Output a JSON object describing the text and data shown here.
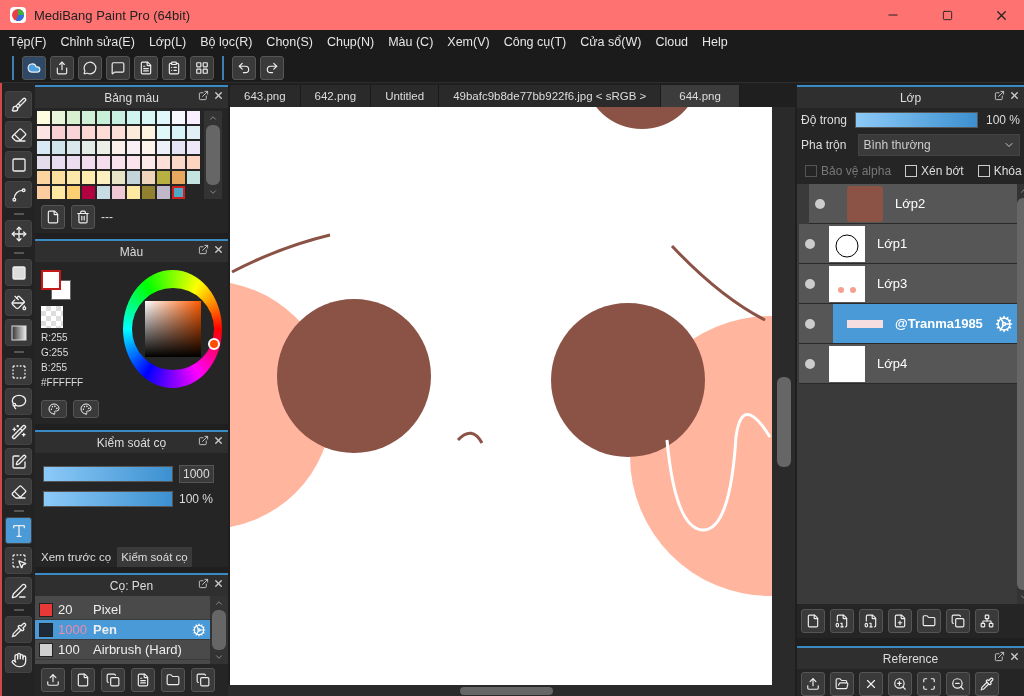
{
  "window": {
    "title": "MediBang Paint Pro (64bit)"
  },
  "menu": [
    "Tệp(F)",
    "Chỉnh sửa(E)",
    "Lớp(L)",
    "Bộ lọc(R)",
    "Chọn(S)",
    "Chụp(N)",
    "Màu (C)",
    "Xem(V)",
    "Công cụ(T)",
    "Cửa sổ(W)",
    "Cloud",
    "Help"
  ],
  "tool_groups": [
    [
      {
        "selected": false
      },
      {
        "selected": false
      },
      {
        "selected": false
      },
      {
        "selected": false
      }
    ],
    [
      {
        "selected": false
      }
    ],
    [
      {
        "selected": false
      },
      {
        "selected": false
      },
      {
        "selected": false
      }
    ],
    [
      {
        "selected": false
      },
      {
        "selected": false
      },
      {
        "selected": false
      },
      {
        "selected": false
      },
      {
        "selected": false
      }
    ],
    [
      {
        "selected": true
      },
      {
        "selected": false
      },
      {
        "selected": false
      }
    ],
    [
      {
        "selected": false
      },
      {
        "selected": false
      }
    ]
  ],
  "palette": {
    "title": "Bảng màu",
    "name": "---",
    "swatches": [
      {
        "color": "#fffde0",
        "selected": false
      },
      {
        "color": "#e8f5d8",
        "selected": false
      },
      {
        "color": "#d8f0d0",
        "selected": false
      },
      {
        "color": "#d0f0d8",
        "selected": false
      },
      {
        "color": "#c8f0d8",
        "selected": false
      },
      {
        "color": "#c8f0e0",
        "selected": false
      },
      {
        "color": "#d0f5f0",
        "selected": false
      },
      {
        "color": "#d8f8f8",
        "selected": false
      },
      {
        "color": "#e0f8fc",
        "selected": false
      },
      {
        "color": "#f8f8ff",
        "selected": false
      },
      {
        "color": "#f8f0ff",
        "selected": false
      },
      {
        "color": "#fce4e4",
        "selected": false
      },
      {
        "color": "#f8d0d4",
        "selected": false
      },
      {
        "color": "#f8d4d8",
        "selected": false
      },
      {
        "color": "#fcd8d4",
        "selected": false
      },
      {
        "color": "#fcdcd4",
        "selected": false
      },
      {
        "color": "#fce0d8",
        "selected": false
      },
      {
        "color": "#fceada",
        "selected": false
      },
      {
        "color": "#fcf4e0",
        "selected": false
      },
      {
        "color": "#e0f8f8",
        "selected": false
      },
      {
        "color": "#d8f4f8",
        "selected": false
      },
      {
        "color": "#e0f0f4",
        "selected": false
      },
      {
        "color": "#d8e8f4",
        "selected": false
      },
      {
        "color": "#d0e4ec",
        "selected": false
      },
      {
        "color": "#d8e8ec",
        "selected": false
      },
      {
        "color": "#e4ece8",
        "selected": false
      },
      {
        "color": "#eceee8",
        "selected": false
      },
      {
        "color": "#fcf0ec",
        "selected": false
      },
      {
        "color": "#f8f0f4",
        "selected": false
      },
      {
        "color": "#fcf4ec",
        "selected": false
      },
      {
        "color": "#ecf0f8",
        "selected": false
      },
      {
        "color": "#e4e4f4",
        "selected": false
      },
      {
        "color": "#ece8f8",
        "selected": false
      },
      {
        "color": "#e4dcec",
        "selected": false
      },
      {
        "color": "#e8dcf0",
        "selected": false
      },
      {
        "color": "#ecdcf0",
        "selected": false
      },
      {
        "color": "#f0dcec",
        "selected": false
      },
      {
        "color": "#f4dcec",
        "selected": false
      },
      {
        "color": "#f8e0ec",
        "selected": false
      },
      {
        "color": "#fce4ec",
        "selected": false
      },
      {
        "color": "#fce8e8",
        "selected": false
      },
      {
        "color": "#fce0d8",
        "selected": false
      },
      {
        "color": "#fcd8c8",
        "selected": false
      },
      {
        "color": "#fcd4c0",
        "selected": false
      },
      {
        "color": "#fcd4a0",
        "selected": false
      },
      {
        "color": "#fce0a0",
        "selected": false
      },
      {
        "color": "#fce8a8",
        "selected": false
      },
      {
        "color": "#fcecb0",
        "selected": false
      },
      {
        "color": "#fcf0c0",
        "selected": false
      },
      {
        "color": "#e8e4c8",
        "selected": false
      },
      {
        "color": "#c4d4d8",
        "selected": false
      },
      {
        "color": "#f0d4bc",
        "selected": false
      },
      {
        "color": "#b8b040",
        "selected": false
      },
      {
        "color": "#e8a860",
        "selected": false
      },
      {
        "color": "#c4e4e0",
        "selected": false
      },
      {
        "color": "#fccca0",
        "selected": false
      },
      {
        "color": "#fce8a0",
        "selected": false
      },
      {
        "color": "#fcd070",
        "selected": false
      },
      {
        "color": "#b00040",
        "selected": false
      },
      {
        "color": "#c8dce4",
        "selected": false
      },
      {
        "color": "#f0c8d4",
        "selected": false
      },
      {
        "color": "#fce8a0",
        "selected": false
      },
      {
        "color": "#908030",
        "selected": false
      },
      {
        "color": "#c0b8c8",
        "selected": false
      },
      {
        "color": "#50a8c8",
        "selected": true
      }
    ]
  },
  "color_panel": {
    "title": "Màu",
    "r": "R:255",
    "g": "G:255",
    "b": "B:255",
    "hex": "#FFFFFF"
  },
  "brush_control": {
    "title": "Kiểm soát cọ",
    "size": {
      "level": 1,
      "value": "1000"
    },
    "opacity": {
      "level": 1,
      "value": "100 %"
    },
    "tabs": [
      {
        "label": "Xem trước cọ",
        "selected": false
      },
      {
        "label": "Kiểm soát cọ",
        "selected": true
      }
    ]
  },
  "brushes": {
    "title": "Cọ: Pen",
    "items": [
      {
        "size": "20",
        "name": "Pixel",
        "color": "#e83838",
        "selected": false
      },
      {
        "size": "1000",
        "name": "Pen",
        "color": "#1e2a38",
        "selected": true
      },
      {
        "size": "100",
        "name": "Airbrush (Hard)",
        "color": "#d0d0d0",
        "selected": false
      }
    ]
  },
  "tabs": [
    {
      "label": "643.png",
      "selected": false
    },
    {
      "label": "642.png",
      "selected": false
    },
    {
      "label": "Untitled",
      "selected": false
    },
    {
      "label": "49bafc9b8de77bb922f6.jpg < sRGB >",
      "selected": false
    },
    {
      "label": "644.png",
      "selected": true
    }
  ],
  "layers": {
    "title": "Lớp",
    "opacity_label": "Độ trong",
    "opacity": {
      "level": 1,
      "value": "100 %"
    },
    "blend_label": "Pha trộn",
    "blend": "Bình thường",
    "options": [
      {
        "label": "Bảo vệ alpha",
        "checked": false,
        "disabled": true
      },
      {
        "label": "Xén bớt",
        "checked": false,
        "disabled": false
      },
      {
        "label": "Khóa",
        "checked": false,
        "disabled": false
      }
    ],
    "items": [
      {
        "name": "Lớp2",
        "clipped": true,
        "selected": false
      },
      {
        "name": "Lớp1",
        "clipped": false,
        "selected": false
      },
      {
        "name": "Lớp3",
        "clipped": false,
        "selected": false
      },
      {
        "name": "@Tranma1985",
        "clipped": false,
        "selected": true
      },
      {
        "name": "Lớp4",
        "clipped": false,
        "selected": false
      }
    ]
  },
  "reference": {
    "title": "Reference"
  }
}
